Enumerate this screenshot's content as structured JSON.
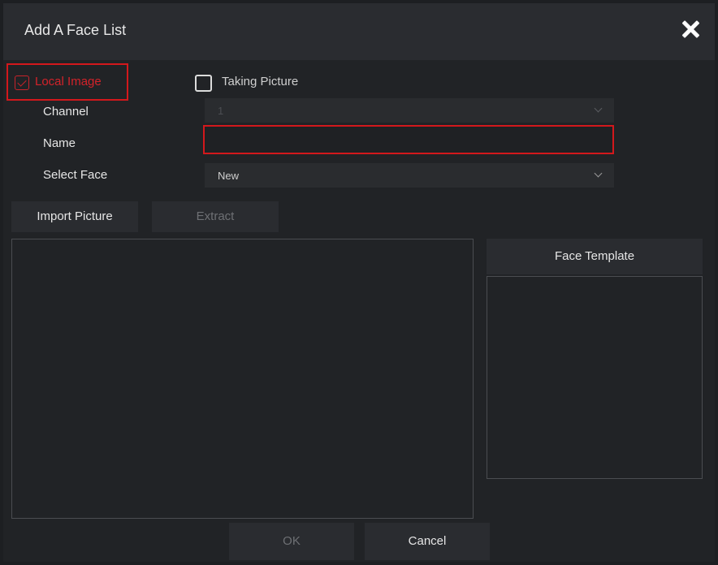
{
  "dialog": {
    "title": "Add A Face List"
  },
  "mode": {
    "local_image": {
      "label": "Local Image",
      "checked": true
    },
    "taking_picture": {
      "label": "Taking Picture",
      "checked": false
    }
  },
  "form": {
    "channel": {
      "label": "Channel",
      "value": "1"
    },
    "name": {
      "label": "Name",
      "value": ""
    },
    "select_face": {
      "label": "Select Face",
      "value": "New"
    }
  },
  "actions": {
    "import_label": "Import Picture",
    "extract_label": "Extract",
    "ok_label": "OK",
    "cancel_label": "Cancel"
  },
  "face_template": {
    "title": "Face Template"
  },
  "colors": {
    "highlight": "#d3181c",
    "background": "#212326",
    "panel": "#2a2c30"
  },
  "icons": {
    "close": "close-icon",
    "chevron": "chevron-down-icon",
    "check": "checkmark-icon"
  }
}
